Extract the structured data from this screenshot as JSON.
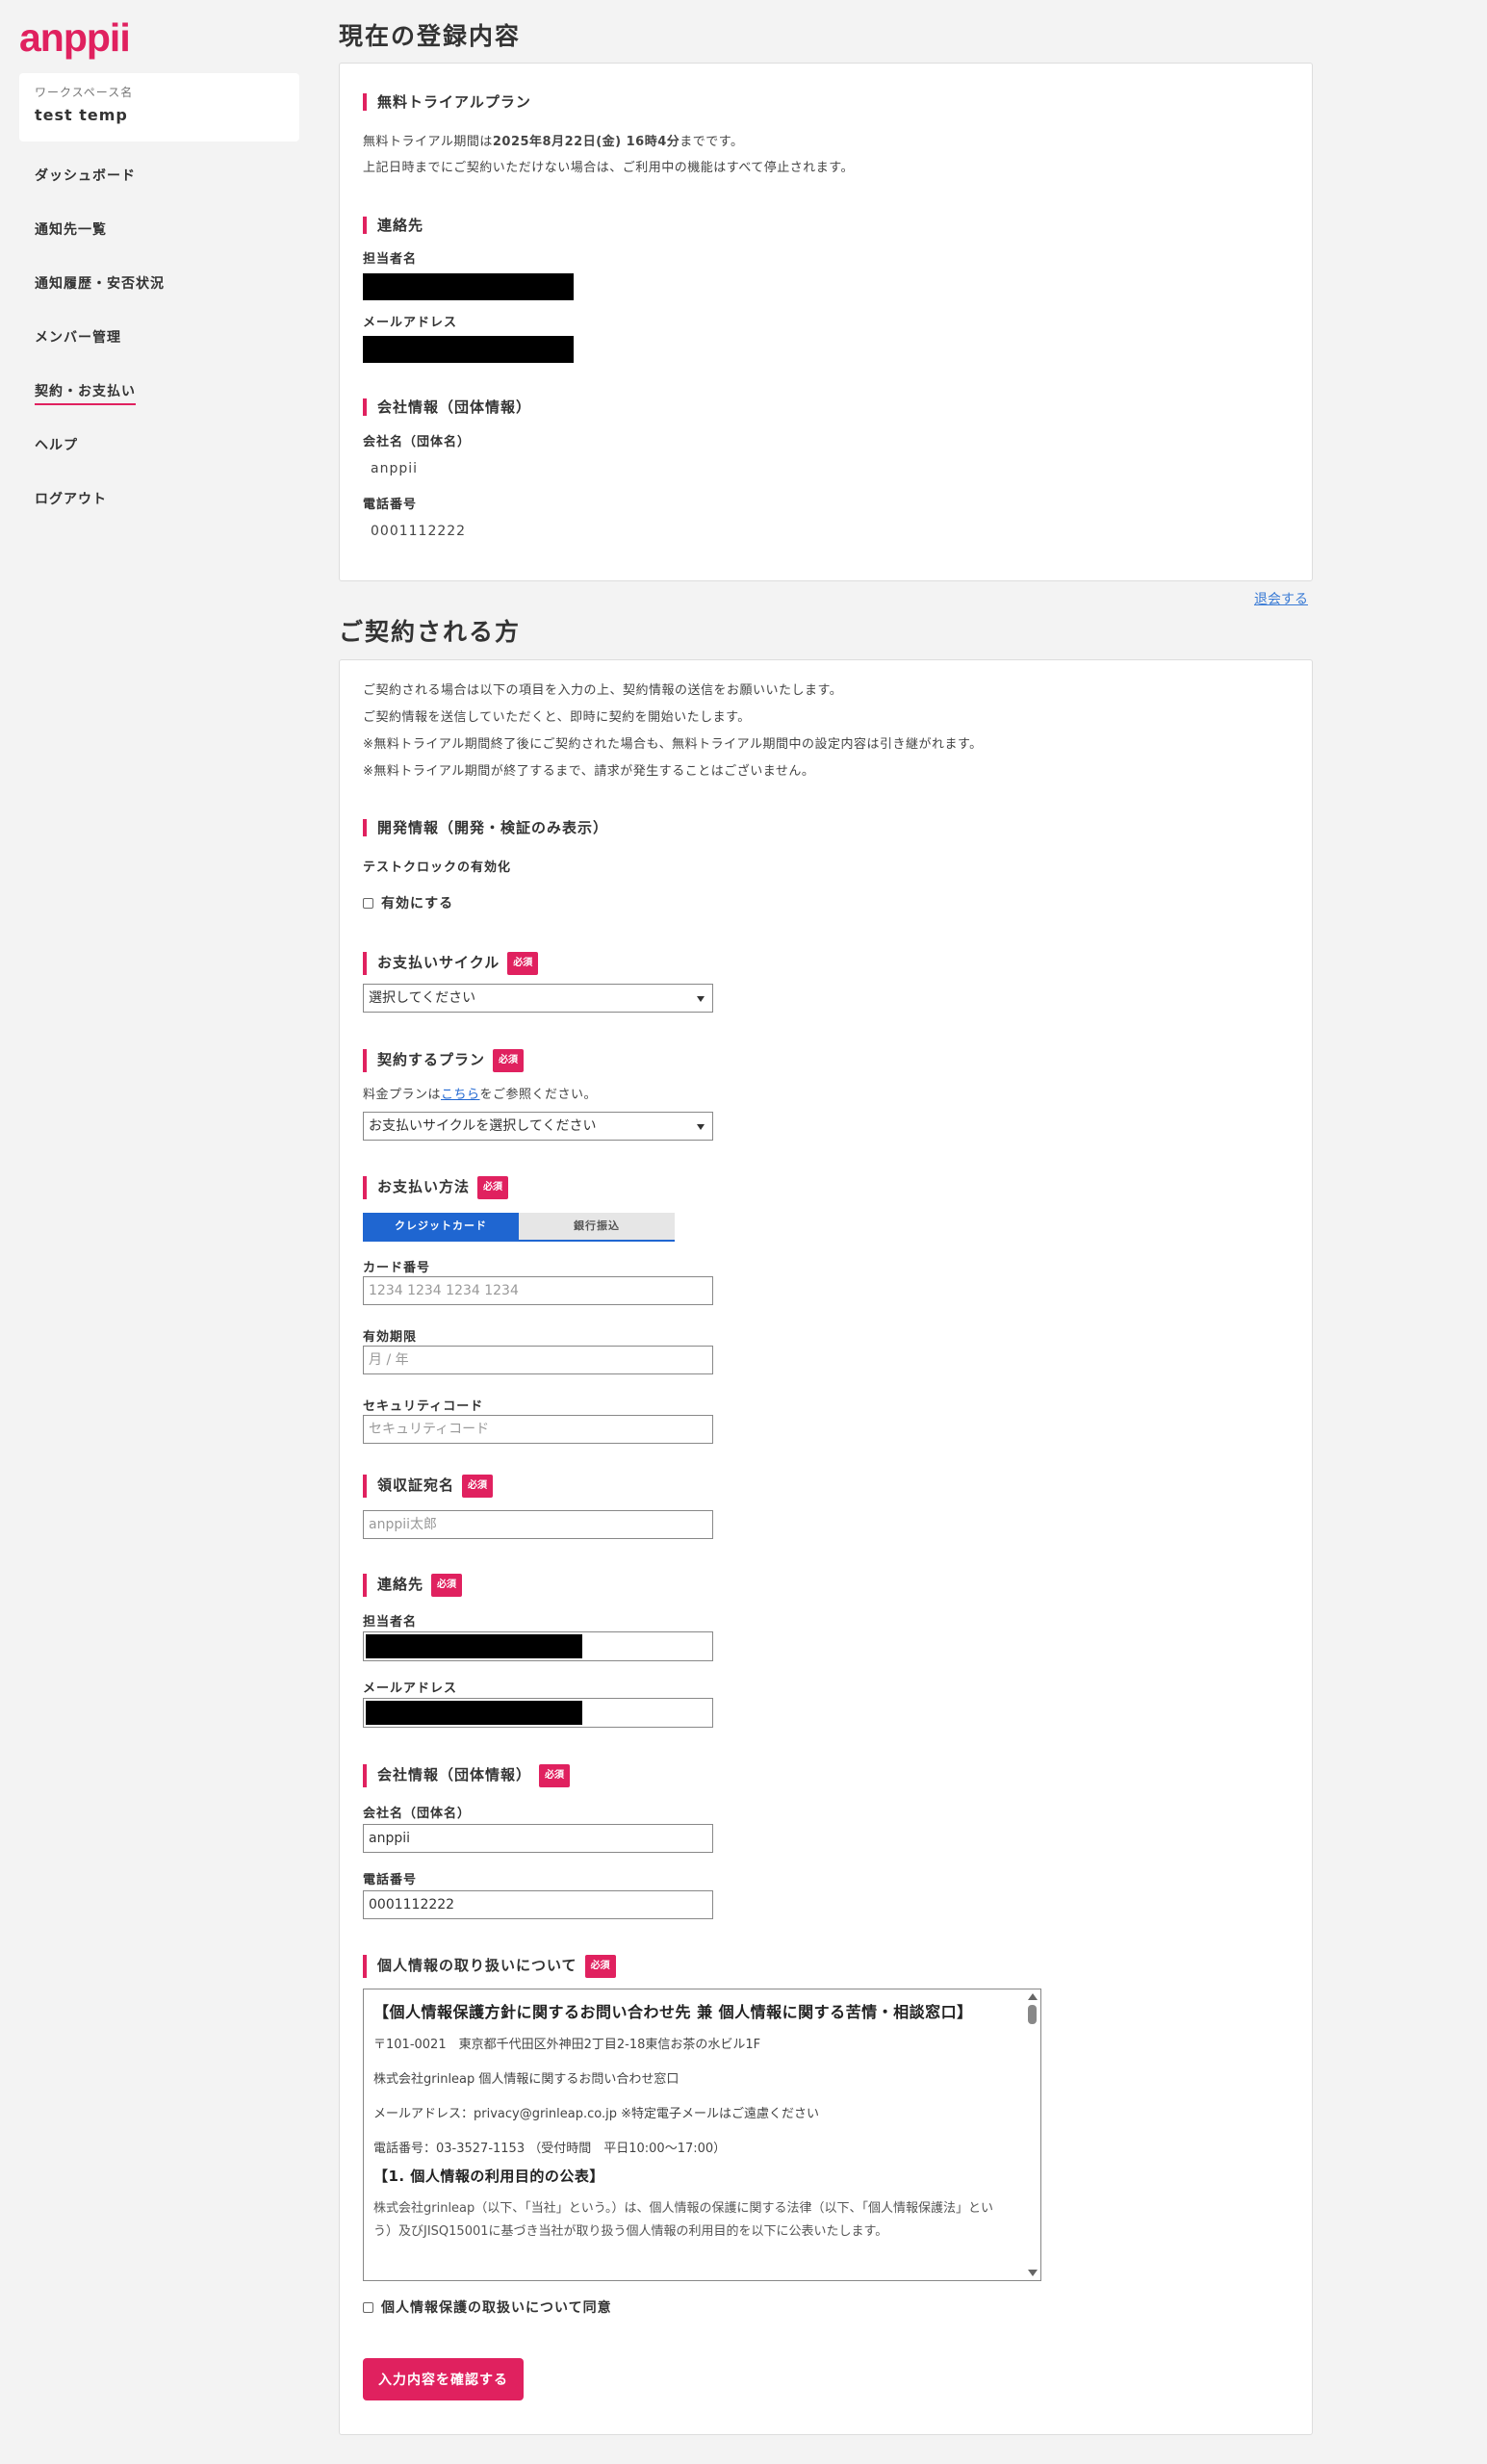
{
  "sidebar": {
    "logo": "anppii",
    "workspace_label": "ワークスペース名",
    "workspace_name": "test temp",
    "nav": [
      {
        "label": "ダッシュボード"
      },
      {
        "label": "通知先一覧"
      },
      {
        "label": "通知履歴・安否状況"
      },
      {
        "label": "メンバー管理"
      },
      {
        "label": "契約・お支払い",
        "active": true
      },
      {
        "label": "ヘルプ"
      },
      {
        "label": "ログアウト"
      }
    ]
  },
  "current": {
    "title": "現在の登録内容",
    "trial_heading": "無料トライアルプラン",
    "trial_line1_pre": "無料トライアル期間は",
    "trial_line1_date": "2025年8月22日(金) 16時4分",
    "trial_line1_post": "までです。",
    "trial_line2": "上記日時までにご契約いただけない場合は、ご利用中の機能はすべて停止されます。",
    "contact_heading": "連絡先",
    "contact_name_label": "担当者名",
    "contact_email_label": "メールアドレス",
    "company_heading": "会社情報（団体情報）",
    "company_name_label": "会社名（団体名）",
    "company_name": "anppii",
    "phone_label": "電話番号",
    "phone": "0001112222",
    "withdraw_link": "退会する"
  },
  "contract": {
    "title": "ご契約される方",
    "intro": [
      "ご契約される場合は以下の項目を入力の上、契約情報の送信をお願いいたします。",
      "ご契約情報を送信していただくと、即時に契約を開始いたします。",
      "※無料トライアル期間終了後にご契約された場合も、無料トライアル期間中の設定内容は引き継がれます。",
      "※無料トライアル期間が終了するまで、請求が発生することはございません。"
    ],
    "dev_heading": "開発情報（開発・検証のみ表示）",
    "test_clock_label": "テストクロックの有効化",
    "test_clock_checkbox": "有効にする",
    "required_badge": "必須",
    "cycle_heading": "お支払いサイクル",
    "cycle_select": "選択してください",
    "plan_heading": "契約するプラン",
    "plan_note_pre": "料金プランは",
    "plan_note_link": "こちら",
    "plan_note_post": "をご参照ください。",
    "plan_select": "お支払いサイクルを選択してください",
    "method_heading": "お支払い方法",
    "tab_card": "クレジットカード",
    "tab_bank": "銀行振込",
    "card_number_label": "カード番号",
    "card_number_placeholder": "1234 1234 1234 1234",
    "expiry_label": "有効期限",
    "expiry_placeholder": "月 / 年",
    "cvc_label": "セキュリティコード",
    "cvc_placeholder": "セキュリティコード",
    "receipt_heading": "領収証宛名",
    "receipt_placeholder": "anppii太郎",
    "contact_heading": "連絡先",
    "contact_name_label": "担当者名",
    "contact_email_label": "メールアドレス",
    "company_heading": "会社情報（団体情報）",
    "company_name_label": "会社名（団体名）",
    "company_name_value": "anppii",
    "phone_label": "電話番号",
    "phone_value": "0001112222",
    "privacy_heading": "個人情報の取り扱いについて",
    "privacy": {
      "title": "【個人情報保護方針に関するお問い合わせ先 兼 個人情報に関する苦情・相談窓口】",
      "address": "〒101-0021　東京都千代田区外神田2丁目2-18東信お茶の水ビル1F",
      "company": "株式会社grinleap 個人情報に関するお問い合わせ窓口",
      "email": "メールアドレス：privacy@grinleap.co.jp ※特定電子メールはご遠慮ください",
      "phone": "電話番号：03-3527-1153 （受付時間　平日10:00〜17:00）",
      "section": "【1. 個人情報の利用目的の公表】",
      "body": "株式会社grinleap（以下、「当社」という。）は、個人情報の保護に関する法律（以下、「個人情報保護法」という）及びJISQ15001に基づき当社が取り扱う個人情報の利用目的を以下に公表いたします。"
    },
    "privacy_agree": "個人情報保護の取扱いについて同意",
    "submit": "入力内容を確認する"
  }
}
